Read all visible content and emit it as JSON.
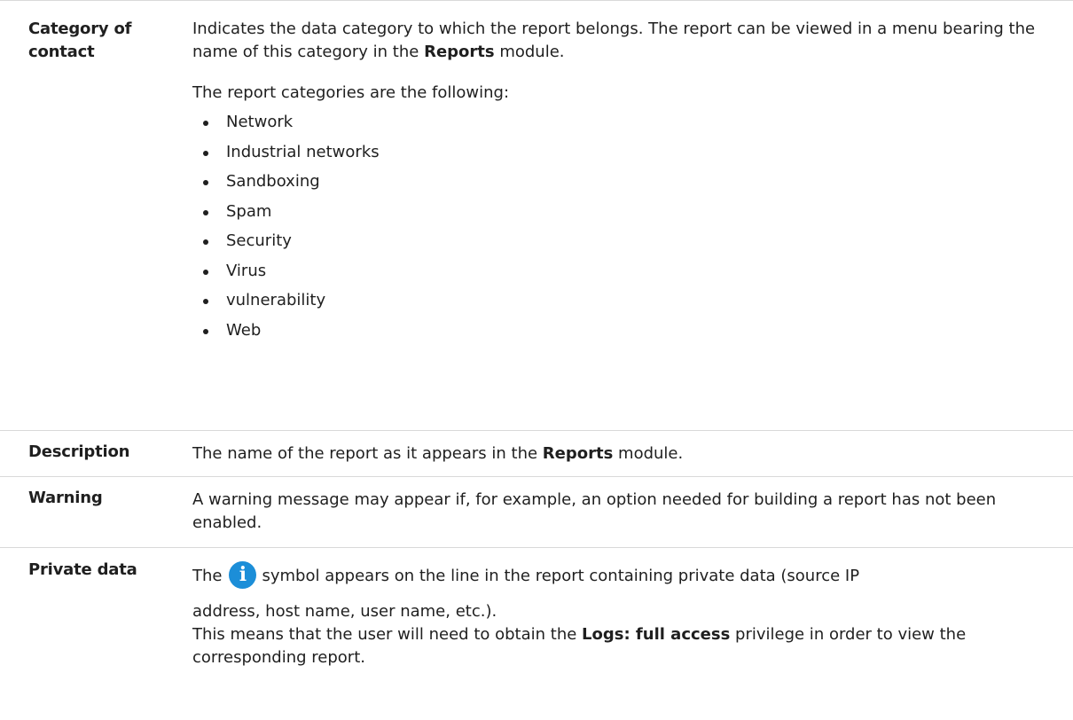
{
  "rows": {
    "category": {
      "term": "Category of contact",
      "intro_a": "Indicates the data category to which the report belongs. The report can be viewed in a menu bearing the name of this category in the ",
      "intro_bold": "Reports",
      "intro_b": " module.",
      "list_intro": "The report categories are the following:",
      "items": [
        "Network",
        "Industrial networks",
        "Sandboxing",
        "Spam",
        "Security",
        "Virus",
        "vulnerability",
        "Web"
      ]
    },
    "description": {
      "term": "Description",
      "text_a": "The name of the report as it appears in the ",
      "text_bold": "Reports",
      "text_b": " module."
    },
    "warning": {
      "term": "Warning",
      "text": "A warning message may appear if, for example, an option needed for building a report has not been enabled."
    },
    "private": {
      "term": "Private data",
      "line1_a": "The",
      "icon_glyph": "i",
      "line1_b": "symbol appears on the line in the report containing private data (source IP",
      "line2": "address, host name, user name, etc.).",
      "line3_a": "This means that the user will need to obtain the ",
      "line3_bold": "Logs: full access",
      "line3_b": " privilege in order to view the corresponding report."
    }
  },
  "colors": {
    "text": "#1f1f1f",
    "rule": "#d9d9d9",
    "info_icon": "#1c8ed8"
  },
  "icons": [
    "info-icon"
  ]
}
